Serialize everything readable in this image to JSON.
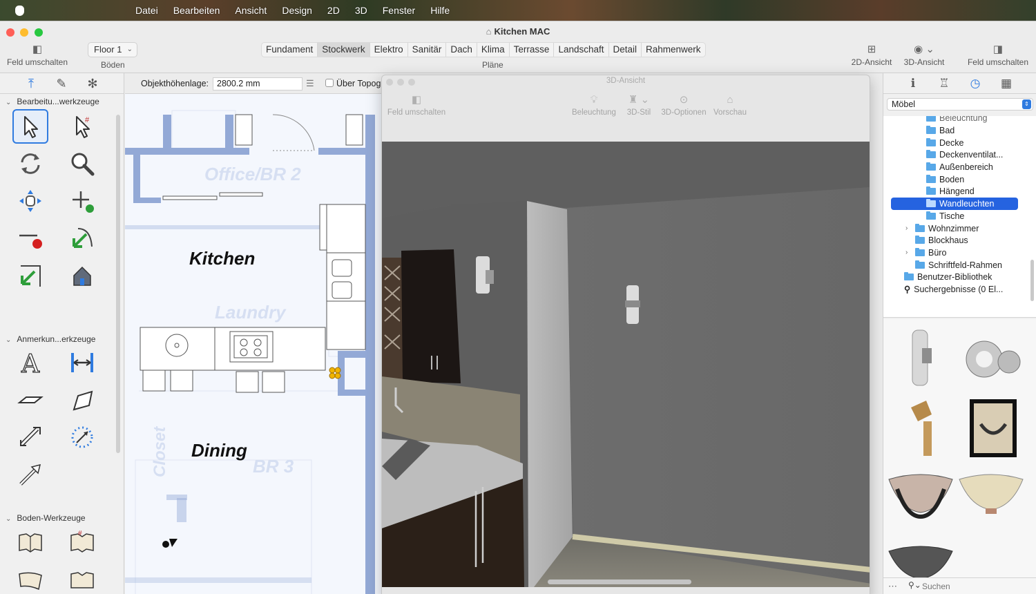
{
  "menubar": {
    "items": [
      "Datei",
      "Bearbeiten",
      "Ansicht",
      "Design",
      "2D",
      "3D",
      "Fenster",
      "Hilfe"
    ]
  },
  "window": {
    "title": "Kitchen MAC",
    "toolbar": {
      "toggle_left_label": "Feld umschalten",
      "floors_label": "Böden",
      "floor_value": "Floor 1",
      "plans_label": "Pläne",
      "plan_tabs": [
        "Fundament",
        "Stockwerk",
        "Elektro",
        "Sanitär",
        "Dach",
        "Klima",
        "Terrasse",
        "Landschaft",
        "Detail",
        "Rahmenwerk"
      ],
      "active_plan_tab": "Stockwerk",
      "view2d_label": "2D-Ansicht",
      "view3d_label": "3D-Ansicht",
      "toggle_right_label": "Feld umschalten"
    }
  },
  "left_panel": {
    "sections": [
      {
        "title": "Bearbeitu...werkzeuge"
      },
      {
        "title": "Anmerkun...erkzeuge"
      },
      {
        "title": "Boden-Werkzeuge"
      }
    ]
  },
  "object_bar": {
    "height_label": "Objekthöhenlage:",
    "height_value": "2800.2 mm",
    "checkbox_label": "Über Topogr"
  },
  "plan": {
    "labels": {
      "office": "Office/BR 2",
      "kitchen": "Kitchen",
      "laundry": "Laundry",
      "closet": "Closet",
      "dining": "Dining",
      "br3": "BR 3"
    }
  },
  "view3d": {
    "title": "3D-Ansicht",
    "buttons": {
      "toggle": "Feld umschalten",
      "lighting": "Beleuchtung",
      "style": "3D-Stil",
      "options": "3D-Optionen",
      "preview": "Vorschau"
    }
  },
  "right_panel": {
    "library_select": "Möbel",
    "tree": [
      {
        "label": "Bad",
        "level": 2,
        "expandable": false
      },
      {
        "label": "Decke",
        "level": 2,
        "expandable": false
      },
      {
        "label": "Deckenventilat...",
        "level": 2,
        "expandable": false
      },
      {
        "label": "Außenbereich",
        "level": 2,
        "expandable": false
      },
      {
        "label": "Boden",
        "level": 2,
        "expandable": false
      },
      {
        "label": "Hängend",
        "level": 2,
        "expandable": false
      },
      {
        "label": "Wandleuchten",
        "level": 2,
        "expandable": false,
        "selected": true
      },
      {
        "label": "Tische",
        "level": 2,
        "expandable": false
      },
      {
        "label": "Wohnzimmer",
        "level": 1,
        "expandable": true
      },
      {
        "label": "Blockhaus",
        "level": 1,
        "expandable": false
      },
      {
        "label": "Büro",
        "level": 1,
        "expandable": true
      },
      {
        "label": "Schriftfeld-Rahmen",
        "level": 1,
        "expandable": false
      },
      {
        "label": "Benutzer-Bibliothek",
        "level": 0,
        "expandable": false
      },
      {
        "label": "Suchergebnisse (0 El...",
        "level": 0,
        "expandable": false,
        "search": true
      }
    ],
    "search_placeholder": "Suchen"
  },
  "colors": {
    "accent": "#2563e0",
    "selection_tool": "#2f7be0",
    "wall_blue": "#93a9d6",
    "scene_wall": "#6e6e6e"
  }
}
